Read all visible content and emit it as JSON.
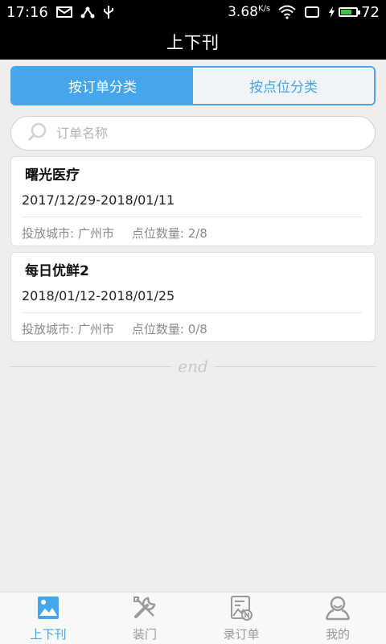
{
  "status_bar": {
    "time": "17:16",
    "net_speed": "3.68",
    "net_unit": "K/s",
    "battery": "72",
    "battery_level": 0.72
  },
  "header": {
    "title": "上下刊"
  },
  "segments": [
    {
      "label": "按订单分类",
      "active": true
    },
    {
      "label": "按点位分类",
      "active": false
    }
  ],
  "search": {
    "placeholder": "订单名称",
    "value": ""
  },
  "orders": [
    {
      "name": "曙光医疗",
      "date_range": "2017/12/29-2018/01/11",
      "city_label": "投放城市:",
      "city": "广州市",
      "count_label": "点位数量:",
      "count": "2/8"
    },
    {
      "name": "每日优鲜2",
      "date_range": "2018/01/12-2018/01/25",
      "city_label": "投放城市:",
      "city": "广州市",
      "count_label": "点位数量:",
      "count": "0/8"
    }
  ],
  "end_text": "end",
  "nav": [
    {
      "label": "上下刊",
      "icon": "picture-icon",
      "active": true
    },
    {
      "label": "装门",
      "icon": "tools-icon",
      "active": false
    },
    {
      "label": "录订单",
      "icon": "record-order-icon",
      "active": false
    },
    {
      "label": "我的",
      "icon": "profile-icon",
      "active": false
    }
  ],
  "colors": {
    "accent": "#45a5ed",
    "header_bg": "#000000",
    "page_bg": "#eeeeee"
  }
}
